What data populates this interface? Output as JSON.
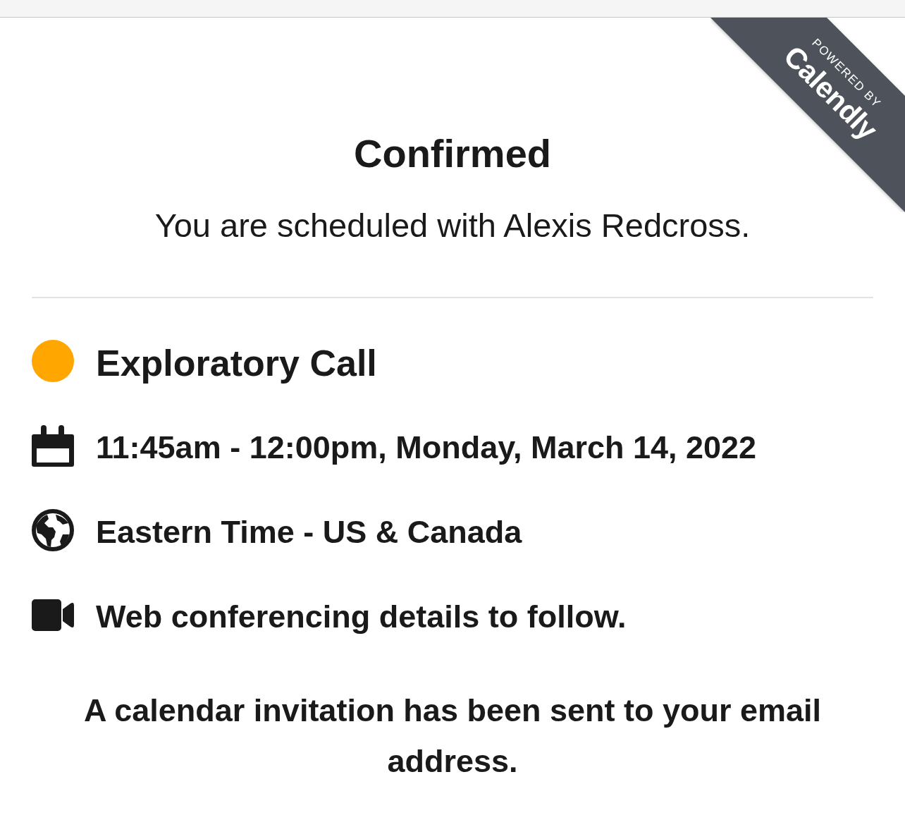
{
  "ribbon": {
    "caption": "POWERED BY",
    "brand": "Calendly"
  },
  "confirmation": {
    "title": "Confirmed",
    "message": "You are scheduled with Alexis Redcross."
  },
  "details": [
    {
      "kind": "event",
      "text": "Exploratory Call",
      "color": "#ffa600"
    },
    {
      "kind": "date",
      "text": "11:45am - 12:00pm, Monday, March 14, 2022"
    },
    {
      "kind": "timezone",
      "text": "Eastern Time - US & Canada"
    },
    {
      "kind": "conferencing",
      "text": "Web conferencing details to follow."
    }
  ],
  "note": "A calendar invitation has been sent to your email address."
}
